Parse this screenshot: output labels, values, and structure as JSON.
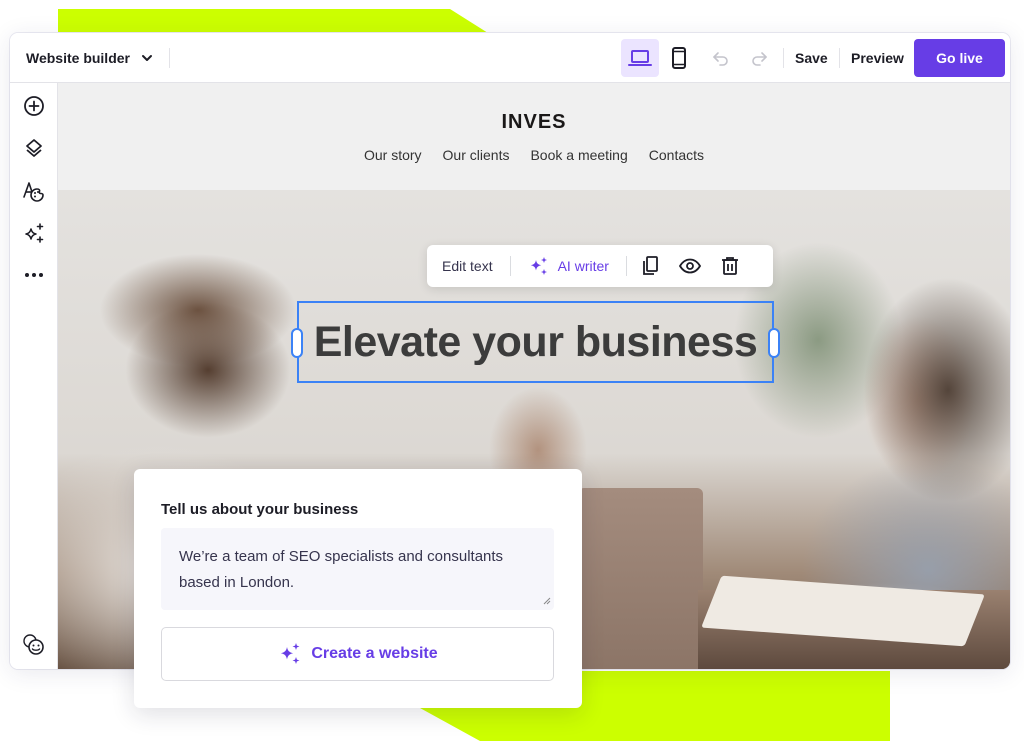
{
  "colors": {
    "accent": "#673de6",
    "selection": "#3b82f6",
    "highlight_green": "#ccff00"
  },
  "topbar": {
    "app_title": "Website builder",
    "app_menu_icon": "chevron-down-icon",
    "devices": [
      {
        "name": "desktop",
        "icon": "laptop-icon",
        "active": true
      },
      {
        "name": "mobile",
        "icon": "mobile-icon",
        "active": false
      }
    ],
    "undo_icon": "undo-icon",
    "redo_icon": "redo-icon",
    "save_label": "Save",
    "preview_label": "Preview",
    "go_live_label": "Go live"
  },
  "sidebar": {
    "items": [
      {
        "name": "add",
        "icon": "plus-circle-icon"
      },
      {
        "name": "layers",
        "icon": "layers-icon"
      },
      {
        "name": "styles",
        "icon": "typography-palette-icon"
      },
      {
        "name": "ai-tools",
        "icon": "sparkles-icon"
      },
      {
        "name": "more",
        "icon": "more-icon"
      }
    ],
    "bottom_icon": "faces-icon"
  },
  "site": {
    "logo": "INVES",
    "nav": [
      "Our story",
      "Our clients",
      "Book a meeting",
      "Contacts"
    ],
    "hero_heading": "Elevate your business"
  },
  "text_toolbar": {
    "edit_text_label": "Edit text",
    "ai_writer_label": "AI writer",
    "icons": [
      "sparkles-icon",
      "duplicate-icon",
      "eye-icon",
      "trash-icon"
    ]
  },
  "ai_card": {
    "label": "Tell us about your business",
    "textarea_value": "We’re a team of SEO specialists and consultants based in London.",
    "button_label": "Create a website"
  }
}
